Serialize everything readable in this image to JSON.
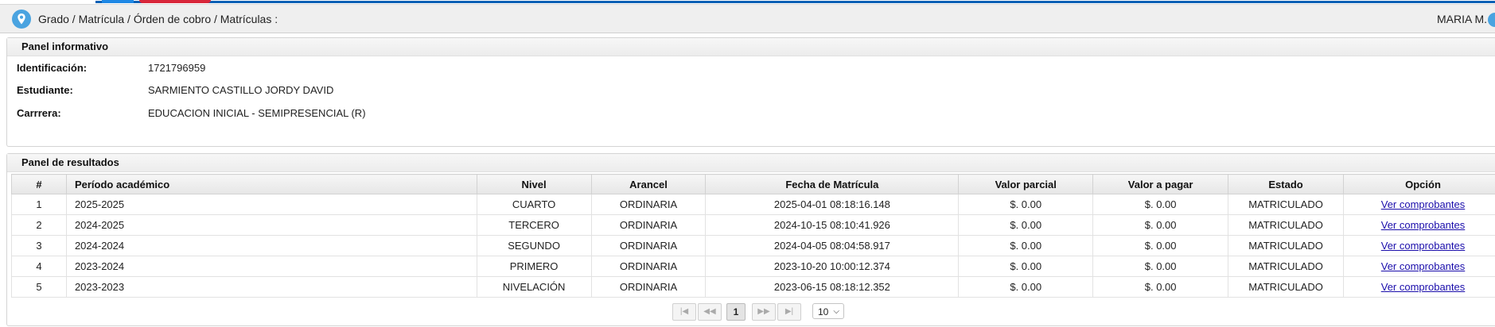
{
  "header": {
    "breadcrumb": "Grado / Matrícula / Órden de cobro / Matrículas :",
    "user": "MARIA M."
  },
  "info_panel": {
    "title": "Panel informativo",
    "rows": [
      {
        "label": "Identificación:",
        "value": "1721796959"
      },
      {
        "label": "Estudiante:",
        "value": "SARMIENTO CASTILLO JORDY DAVID"
      },
      {
        "label": "Carrrera:",
        "value": "EDUCACION INICIAL - SEMIPRESENCIAL (R)"
      }
    ]
  },
  "results_panel": {
    "title": "Panel de resultados",
    "columns": [
      "#",
      "Período académico",
      "Nivel",
      "Arancel",
      "Fecha de Matrícula",
      "Valor parcial",
      "Valor a pagar",
      "Estado",
      "Opción"
    ],
    "rows": [
      {
        "n": "1",
        "periodo": "2025-2025",
        "nivel": "CUARTO",
        "arancel": "ORDINARIA",
        "fecha": "2025-04-01 08:18:16.148",
        "parcial": "$. 0.00",
        "pagar": "$. 0.00",
        "estado": "MATRICULADO",
        "opcion": "Ver comprobantes"
      },
      {
        "n": "2",
        "periodo": "2024-2025",
        "nivel": "TERCERO",
        "arancel": "ORDINARIA",
        "fecha": "2024-10-15 08:10:41.926",
        "parcial": "$. 0.00",
        "pagar": "$. 0.00",
        "estado": "MATRICULADO",
        "opcion": "Ver comprobantes"
      },
      {
        "n": "3",
        "periodo": "2024-2024",
        "nivel": "SEGUNDO",
        "arancel": "ORDINARIA",
        "fecha": "2024-04-05 08:04:58.917",
        "parcial": "$. 0.00",
        "pagar": "$. 0.00",
        "estado": "MATRICULADO",
        "opcion": "Ver comprobantes"
      },
      {
        "n": "4",
        "periodo": "2023-2024",
        "nivel": "PRIMERO",
        "arancel": "ORDINARIA",
        "fecha": "2023-10-20 10:00:12.374",
        "parcial": "$. 0.00",
        "pagar": "$. 0.00",
        "estado": "MATRICULADO",
        "opcion": "Ver comprobantes"
      },
      {
        "n": "5",
        "periodo": "2023-2023",
        "nivel": "NIVELACIÓN",
        "arancel": "ORDINARIA",
        "fecha": "2023-06-15 08:18:12.352",
        "parcial": "$. 0.00",
        "pagar": "$. 0.00",
        "estado": "MATRICULADO",
        "opcion": "Ver comprobantes"
      }
    ],
    "paginator": {
      "first": "|◀",
      "prev": "◀◀",
      "current_page": "1",
      "next": "▶▶",
      "last": "▶|",
      "rows_per_page": "10"
    }
  },
  "colors": {
    "accent_blue": "#0a5fb4",
    "pin_blue": "#4aa3e0",
    "link": "#1a0dab"
  }
}
